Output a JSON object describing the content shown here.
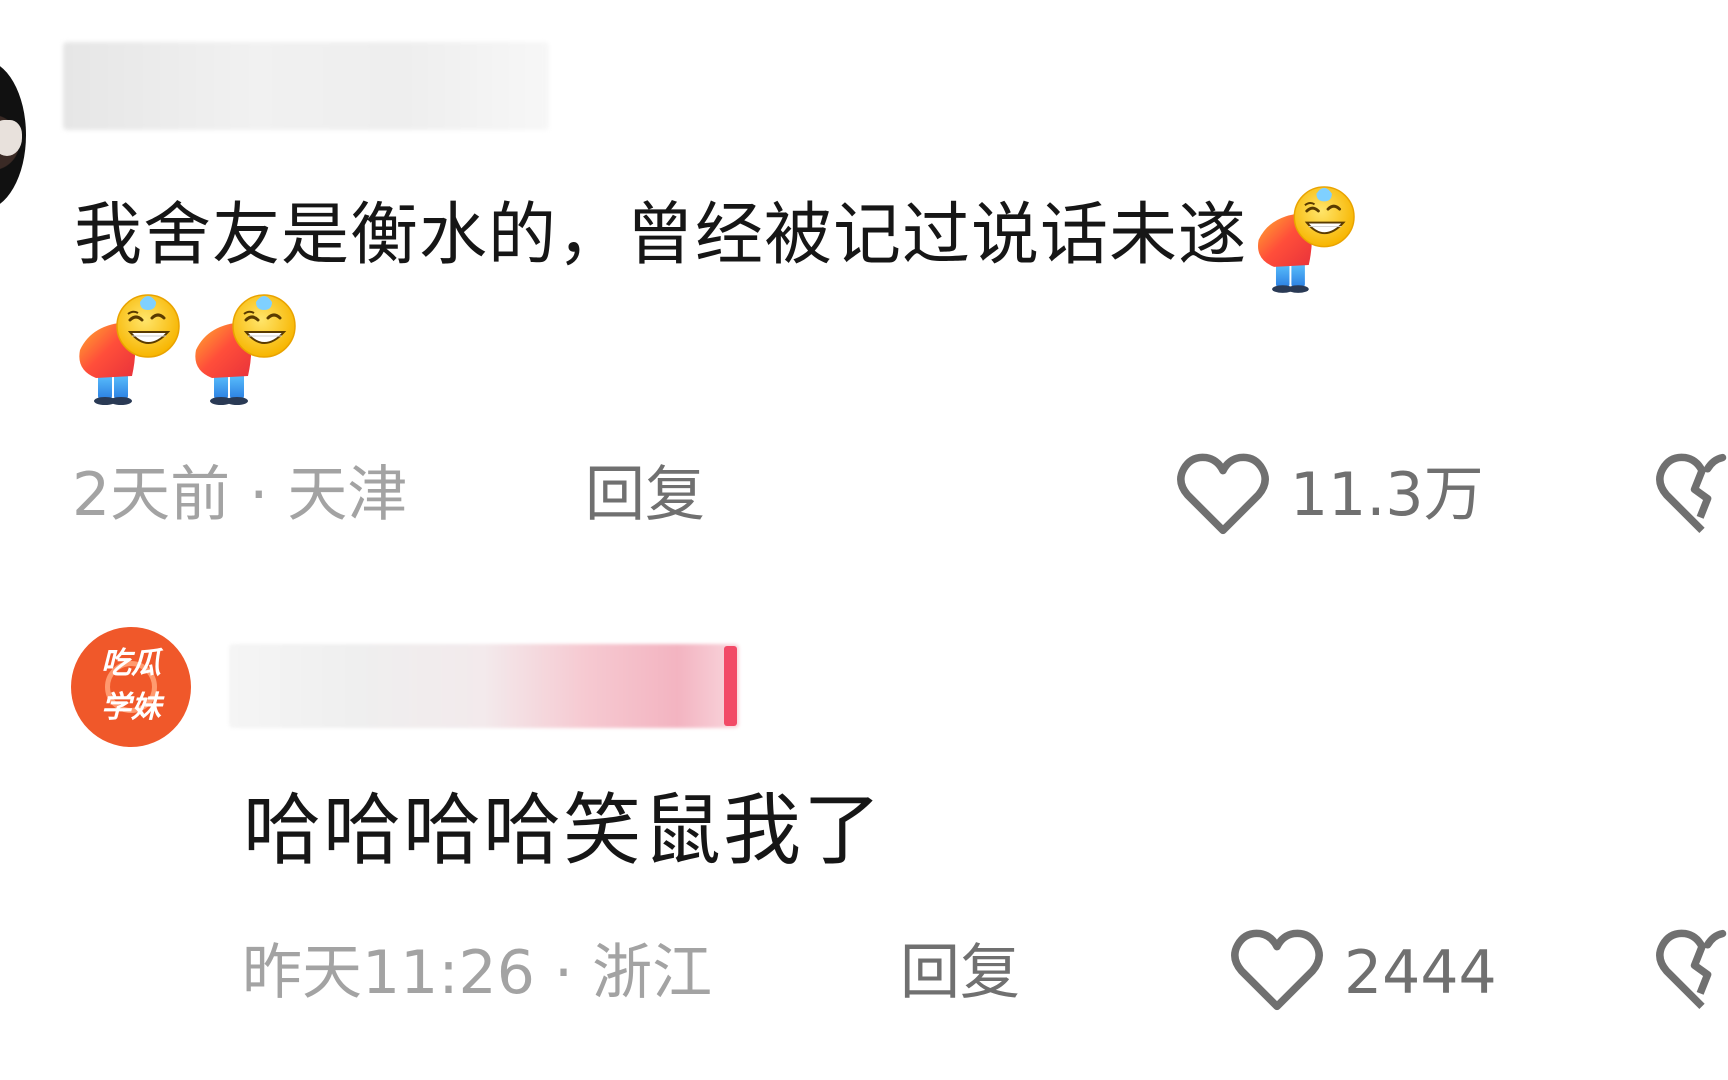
{
  "comments": [
    {
      "text": "我舍友是衡水的，曾经被记过说话未遂",
      "emoji_name": "bowing-sweat-emoji",
      "meta": "2天前 · 天津",
      "reply_label": "回复",
      "like_count": "11.3万"
    },
    {
      "text": "哈哈哈哈笑鼠我了",
      "avatar_text": [
        "吃瓜",
        "学妹"
      ],
      "meta": "昨天11:26 · 浙江",
      "reply_label": "回复",
      "like_count": "2444"
    }
  ],
  "colors": {
    "meta_text": "#a3a3a3",
    "action_text": "#707070",
    "avatar_bg": "#f0582a",
    "name_accent": "#f24a67"
  }
}
